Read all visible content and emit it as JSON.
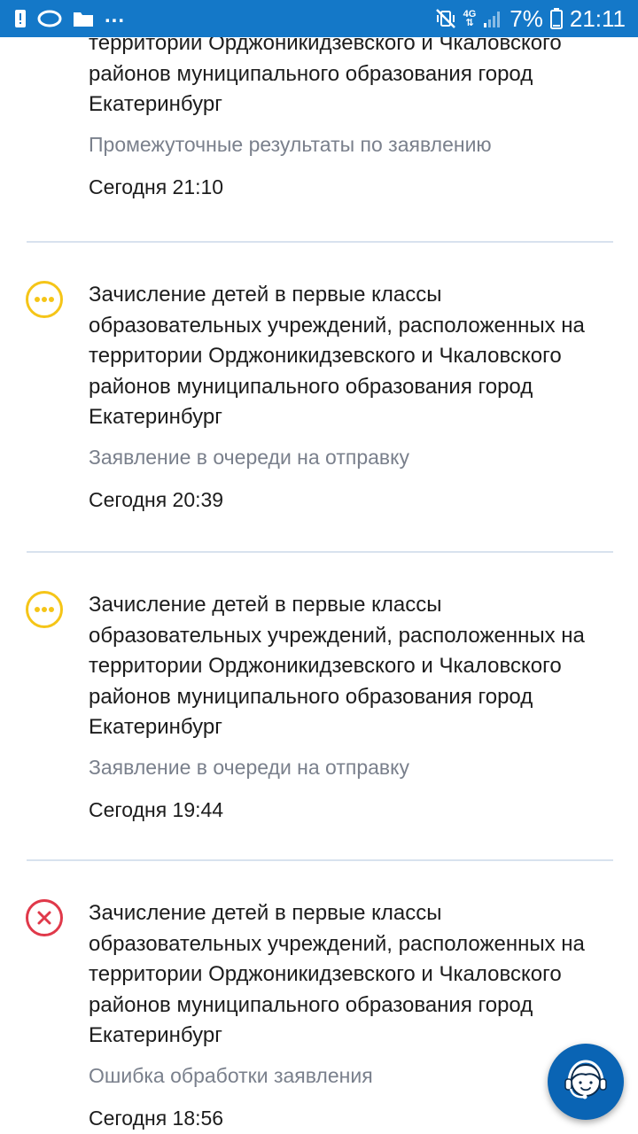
{
  "status_bar": {
    "more": "...",
    "network": "4G",
    "battery_percent": "7%",
    "time": "21:11"
  },
  "applications": [
    {
      "title_tail": "территории Орджоникидзевского и Чкаловского районов муниципального образования город Екатеринбург",
      "status": "Промежуточные результаты по заявлению",
      "status_icon": "",
      "time": "Сегодня 21:10"
    },
    {
      "title": "Зачисление детей в первые классы образовательных учреждений, расположенных на территории Орджоникидзевского и Чкаловского районов муниципального образования город Екатеринбург",
      "status": "Заявление в очереди на отправку",
      "status_icon": "pending-icon",
      "time": "Сегодня 20:39"
    },
    {
      "title": "Зачисление детей в первые классы образовательных учреждений, расположенных на территории Орджоникидзевского и Чкаловского районов муниципального образования город Екатеринбург",
      "status": "Заявление в очереди на отправку",
      "status_icon": "pending-icon",
      "time": "Сегодня 19:44"
    },
    {
      "title": "Зачисление детей в первые классы образовательных учреждений, расположенных на территории Орджоникидзевского и Чкаловского районов муниципального образования город Екатеринбург",
      "status": "Ошибка обработки заявления",
      "status_icon": "error-icon",
      "time": "Сегодня 18:56"
    }
  ],
  "colors": {
    "status_bar": "#1478c8",
    "pending": "#f5c518",
    "error": "#e0394a",
    "fab": "#0a64b4"
  },
  "support_button": {
    "icon": "support-agent-icon"
  }
}
